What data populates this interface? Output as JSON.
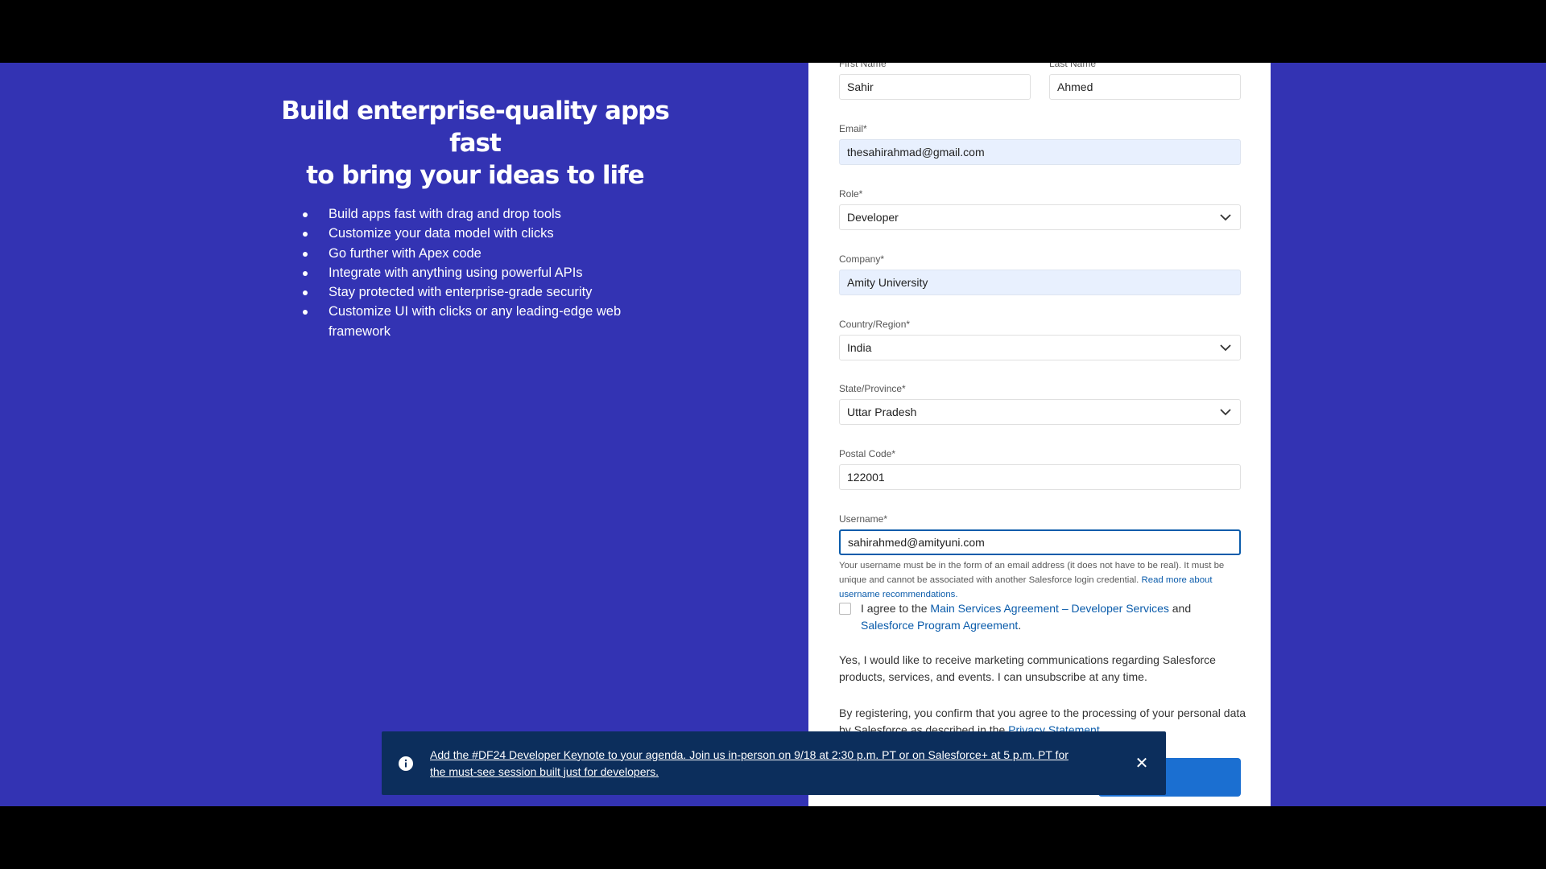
{
  "hero": {
    "title_line1": "Build enterprise-quality apps fast",
    "title_line2": "to bring your ideas to life",
    "bullets": [
      "Build apps fast with drag and drop tools",
      "Customize your data model with clicks",
      "Go further with Apex code",
      "Integrate with anything using powerful APIs",
      "Stay protected with enterprise-grade security",
      "Customize UI with clicks or any leading-edge web framework"
    ]
  },
  "form": {
    "first_name": {
      "label": "First Name",
      "value": "Sahir"
    },
    "last_name": {
      "label": "Last Name",
      "value": "Ahmed"
    },
    "email": {
      "label": "Email*",
      "value": "thesahirahmad@gmail.com"
    },
    "role": {
      "label": "Role*",
      "value": "Developer"
    },
    "company": {
      "label": "Company*",
      "value": "Amity University"
    },
    "country": {
      "label": "Country/Region*",
      "value": "India"
    },
    "state": {
      "label": "State/Province*",
      "value": "Uttar Pradesh"
    },
    "postal": {
      "label": "Postal Code*",
      "value": "122001"
    },
    "username": {
      "label": "Username*",
      "value": "sahirahmed@amityuni.com"
    },
    "username_help": "Your username must be in the form of an email address (it does not have to be real). It must be unique and cannot be associated with another Salesforce login credential.",
    "username_help_link": "Read more about username recommendations.",
    "agree_prefix": "I agree to the",
    "agree_link1": "Main Services Agreement – Developer Services",
    "agree_and": "and",
    "agree_link2": "Salesforce Program Agreement",
    "agree_suffix": ".",
    "marketing": "Yes, I would like to receive marketing communications regarding Salesforce products, services, and events. I can unsubscribe at any time.",
    "privacy_prefix": "By registering, you confirm that you agree to the processing of your personal data by Salesforce as described in the",
    "privacy_link": "Privacy Statement",
    "privacy_suffix": "."
  },
  "toast": {
    "message": "Add the #DF24 Developer Keynote to your agenda. Join us in-person on 9/18 at 2:30 p.m. PT or on Salesforce+ at 5 p.m. PT for the must-see session built just for developers.",
    "close_symbol": "✕",
    "icon": "info-icon"
  },
  "colors": {
    "background": "#3333b3",
    "link": "#0b5cab",
    "toast_bg": "#0c2e5c",
    "button": "#1b6fd1"
  }
}
